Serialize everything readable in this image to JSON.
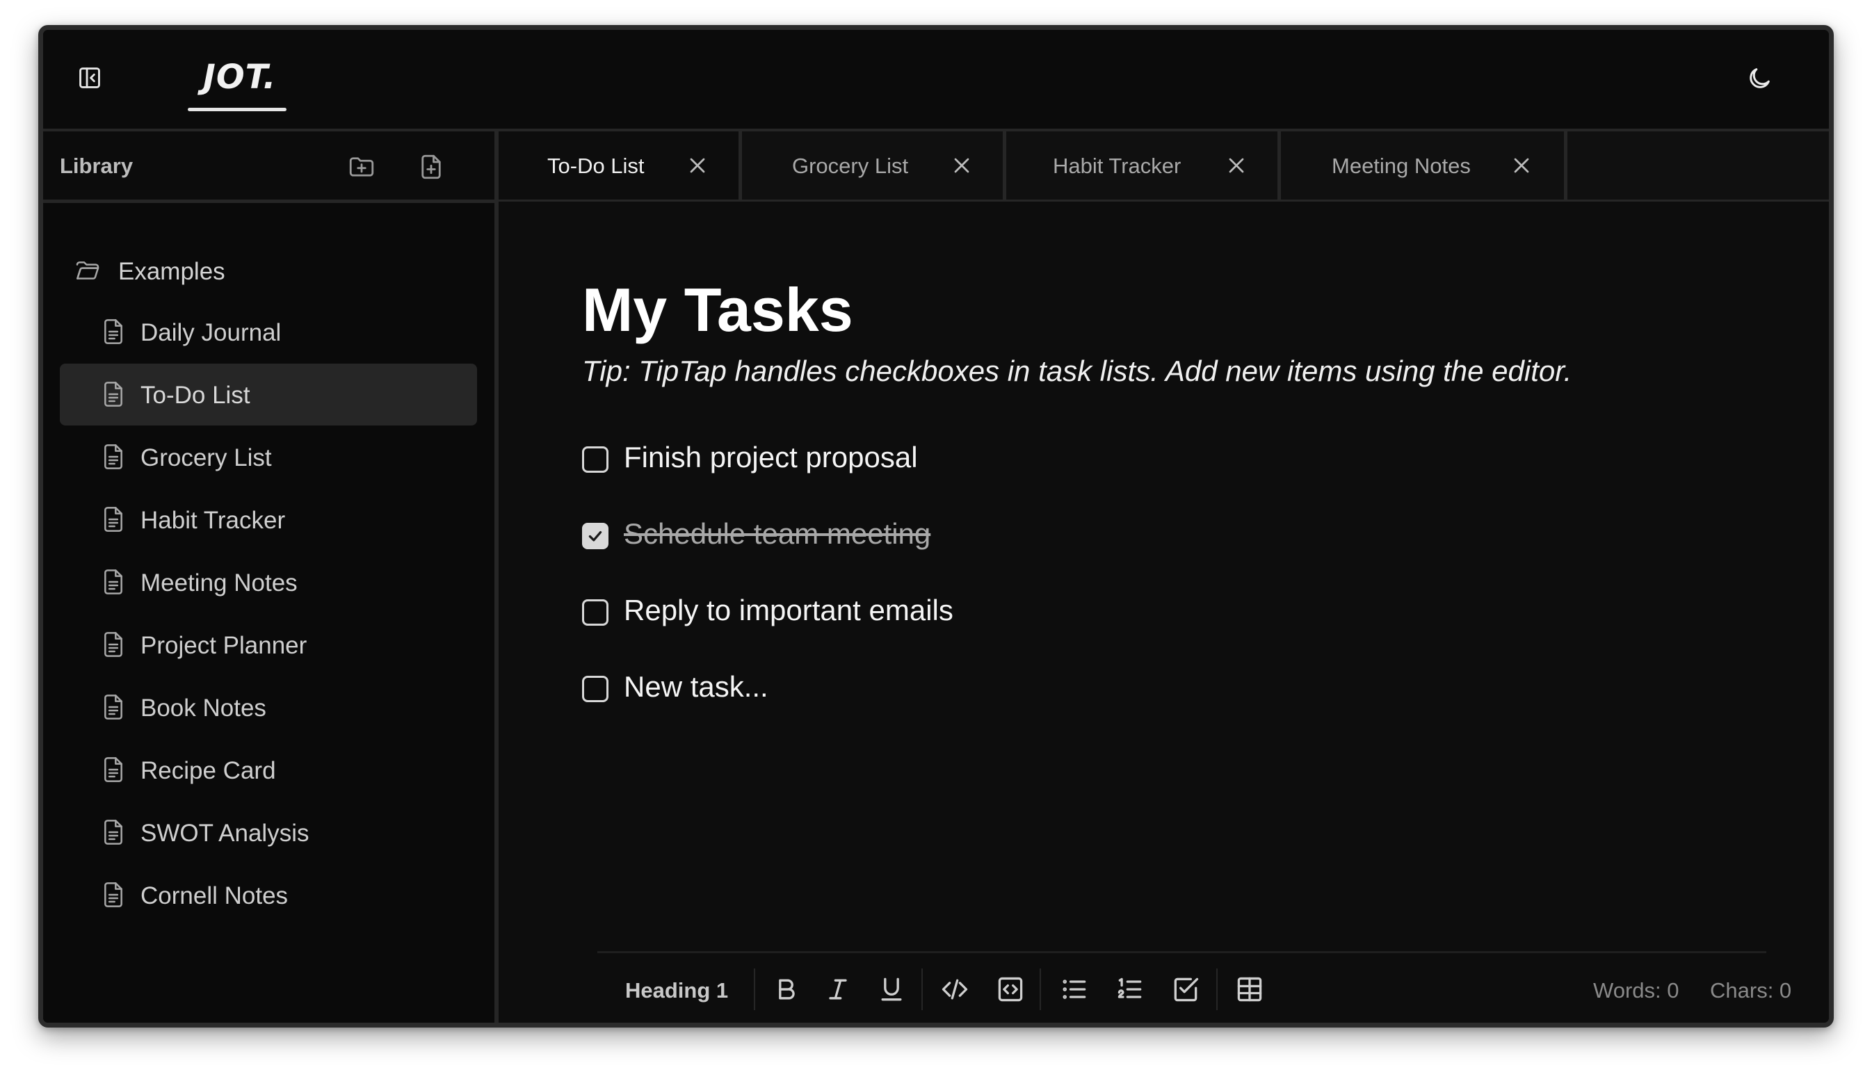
{
  "app": {
    "logo_text": "JOT.",
    "sidebar_toggle_icon": "sidebar-collapse-icon",
    "theme_icon": "moon-icon"
  },
  "sidebar": {
    "title": "Library",
    "new_folder_icon": "new-folder-icon",
    "new_file_icon": "new-file-icon",
    "folder": {
      "label": "Examples",
      "icon": "folder-icon"
    },
    "items": [
      {
        "label": "Daily Journal",
        "active": false
      },
      {
        "label": "To-Do List",
        "active": true
      },
      {
        "label": "Grocery List",
        "active": false
      },
      {
        "label": "Habit Tracker",
        "active": false
      },
      {
        "label": "Meeting Notes",
        "active": false
      },
      {
        "label": "Project Planner",
        "active": false
      },
      {
        "label": "Book Notes",
        "active": false
      },
      {
        "label": "Recipe Card",
        "active": false
      },
      {
        "label": "SWOT Analysis",
        "active": false
      },
      {
        "label": "Cornell Notes",
        "active": false
      }
    ]
  },
  "tabs": [
    {
      "label": "To-Do List",
      "active": true
    },
    {
      "label": "Grocery List",
      "active": false
    },
    {
      "label": "Habit Tracker",
      "active": false
    },
    {
      "label": "Meeting Notes",
      "active": false
    }
  ],
  "document": {
    "title": "My Tasks",
    "tip": "Tip: TipTap handles checkboxes in task lists. Add new items using the editor.",
    "tasks": [
      {
        "text": "Finish project proposal",
        "checked": false
      },
      {
        "text": "Schedule team meeting",
        "checked": true
      },
      {
        "text": "Reply to important emails",
        "checked": false
      },
      {
        "text": "New task...",
        "checked": false
      }
    ]
  },
  "toolbar": {
    "heading_label": "Heading 1",
    "words_label": "Words: 0",
    "chars_label": "Chars: 0",
    "buttons": [
      "bold-icon",
      "italic-icon",
      "underline-icon",
      "code-icon",
      "code-block-icon",
      "bullet-list-icon",
      "ordered-list-icon",
      "task-list-icon",
      "table-icon"
    ]
  },
  "colors": {
    "background": "#0d0d0d",
    "text": "#f5f5f5",
    "muted": "#8a8a8a",
    "active_item": "#262626",
    "border": "#262626"
  }
}
